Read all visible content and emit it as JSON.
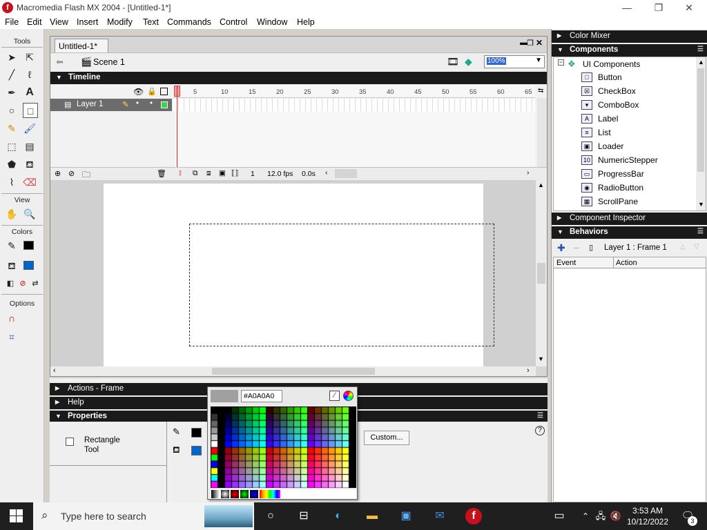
{
  "window": {
    "title": "Macromedia Flash MX 2004 - [Untitled-1*]",
    "minimize": "—",
    "restore": "❐",
    "close": "✕"
  },
  "menu": [
    "File",
    "Edit",
    "View",
    "Insert",
    "Modify",
    "Text",
    "Commands",
    "Control",
    "Window",
    "Help"
  ],
  "tools": {
    "header": "Tools",
    "view_header": "View",
    "colors_header": "Colors",
    "options_header": "Options",
    "stroke_color": "#000000",
    "fill_color": "#0066cc"
  },
  "document": {
    "tab": "Untitled-1*",
    "scene": "Scene 1",
    "zoom": "100%",
    "doc_close": "✕"
  },
  "timeline": {
    "header": "Timeline",
    "layer_name": "Layer 1",
    "frame_numbers": [
      "5",
      "10",
      "15",
      "20",
      "25",
      "30",
      "35",
      "40",
      "45",
      "50",
      "55",
      "60",
      "65"
    ],
    "current_frame": "1",
    "fps": "12.0 fps",
    "time": "0.0s"
  },
  "panels": {
    "actions": "Actions - Frame",
    "help": "Help",
    "properties": "Properties",
    "tool_name_line1": "Rectangle",
    "tool_name_line2": "Tool",
    "custom_button": "Custom..."
  },
  "picker": {
    "hex": "#A0A0A0",
    "preview_color": "#a0a0a0"
  },
  "right": {
    "color_mixer": "Color Mixer",
    "components": "Components",
    "ui_components": "UI Components",
    "component_items": [
      {
        "label": "Button",
        "icon": "□"
      },
      {
        "label": "CheckBox",
        "icon": "☒"
      },
      {
        "label": "ComboBox",
        "icon": "▾"
      },
      {
        "label": "Label",
        "icon": "A"
      },
      {
        "label": "List",
        "icon": "≡"
      },
      {
        "label": "Loader",
        "icon": "▣"
      },
      {
        "label": "NumericStepper",
        "icon": "10"
      },
      {
        "label": "ProgressBar",
        "icon": "▭"
      },
      {
        "label": "RadioButton",
        "icon": "◉"
      },
      {
        "label": "ScrollPane",
        "icon": "▦"
      }
    ],
    "component_inspector": "Component Inspector",
    "behaviors": "Behaviors",
    "behaviors_target": "Layer 1 : Frame 1",
    "col_event": "Event",
    "col_action": "Action"
  },
  "taskbar": {
    "search_placeholder": "Type here to search",
    "time": "3:53 AM",
    "date": "10/12/2022",
    "notification_count": "3"
  }
}
